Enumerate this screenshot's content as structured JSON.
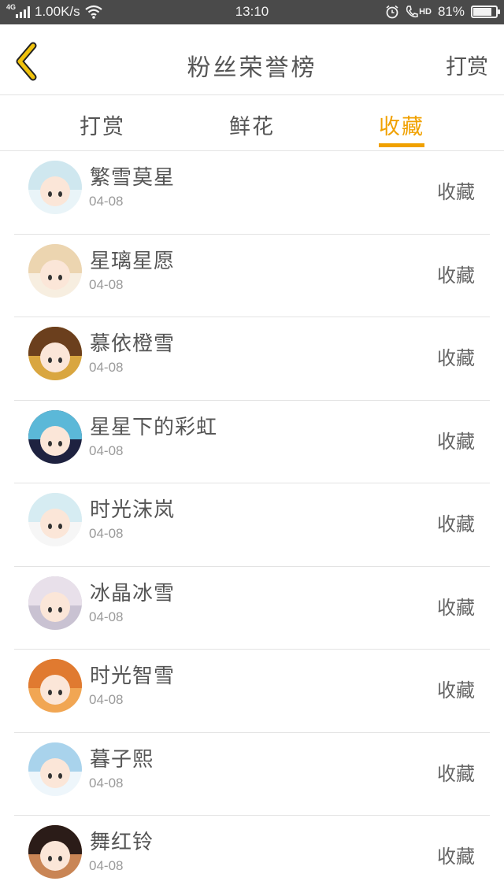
{
  "status_bar": {
    "network": "4G",
    "speed": "1.00K/s",
    "time": "13:10",
    "hd": "HD",
    "battery": "81%",
    "battery_level": 0.81
  },
  "header": {
    "back_icon": "chevron-left-icon",
    "title": "粉丝荣誉榜",
    "right_action": "打赏",
    "accent_color": "#f0a100"
  },
  "tabs": [
    {
      "label": "打赏",
      "active": false
    },
    {
      "label": "鲜花",
      "active": false
    },
    {
      "label": "收藏",
      "active": true
    }
  ],
  "fans": [
    {
      "name": "繁雪莫星",
      "date": "04-08",
      "type": "收藏",
      "hair": "#cfe7ef",
      "bg": "#e9f4f8"
    },
    {
      "name": "星璃星愿",
      "date": "04-08",
      "type": "收藏",
      "hair": "#ecd5b0",
      "bg": "#f7eee0"
    },
    {
      "name": "慕依橙雪",
      "date": "04-08",
      "type": "收藏",
      "hair": "#6b3f1d",
      "bg": "#d9a640"
    },
    {
      "name": "星星下的彩虹",
      "date": "04-08",
      "type": "收藏",
      "hair": "#5bb8d8",
      "bg": "#1e2240"
    },
    {
      "name": "时光沫岚",
      "date": "04-08",
      "type": "收藏",
      "hair": "#d6ecf2",
      "bg": "#f6f6f6"
    },
    {
      "name": "冰晶冰雪",
      "date": "04-08",
      "type": "收藏",
      "hair": "#e8e0ea",
      "bg": "#c9c2d2"
    },
    {
      "name": "时光智雪",
      "date": "04-08",
      "type": "收藏",
      "hair": "#e07a30",
      "bg": "#f1a653"
    },
    {
      "name": "暮子熙",
      "date": "04-08",
      "type": "收藏",
      "hair": "#a9d3ec",
      "bg": "#eef6fb"
    },
    {
      "name": "舞红铃",
      "date": "04-08",
      "type": "收藏",
      "hair": "#2b1c18",
      "bg": "#c98555"
    }
  ]
}
